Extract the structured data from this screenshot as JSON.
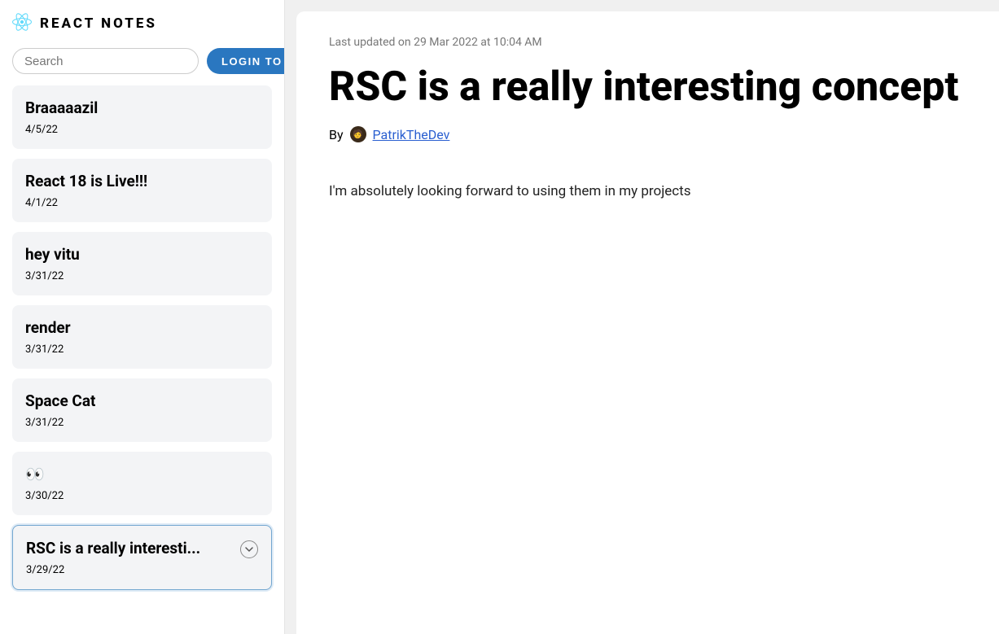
{
  "brand": {
    "title": "REACT NOTES"
  },
  "controls": {
    "search_placeholder": "Search",
    "login_label": "LOGIN TO ADD"
  },
  "notes": [
    {
      "title": "Braaaaazil",
      "date": "4/5/22",
      "selected": false
    },
    {
      "title": "React 18 is Live!!!",
      "date": "4/1/22",
      "selected": false
    },
    {
      "title": "hey vitu",
      "date": "3/31/22",
      "selected": false
    },
    {
      "title": "render",
      "date": "3/31/22",
      "selected": false
    },
    {
      "title": "Space Cat",
      "date": "3/31/22",
      "selected": false
    },
    {
      "title": "👀",
      "date": "3/30/22",
      "selected": false
    },
    {
      "title": "RSC is a really interesti...",
      "date": "3/29/22",
      "selected": true
    }
  ],
  "detail": {
    "updated": "Last updated on 29 Mar 2022 at 10:04 AM",
    "heading": "RSC is a really interesting concept",
    "by_label": "By",
    "author": "PatrikTheDev",
    "avatar_emoji": "🧑",
    "body": "I'm absolutely looking forward to using them in my projects"
  }
}
